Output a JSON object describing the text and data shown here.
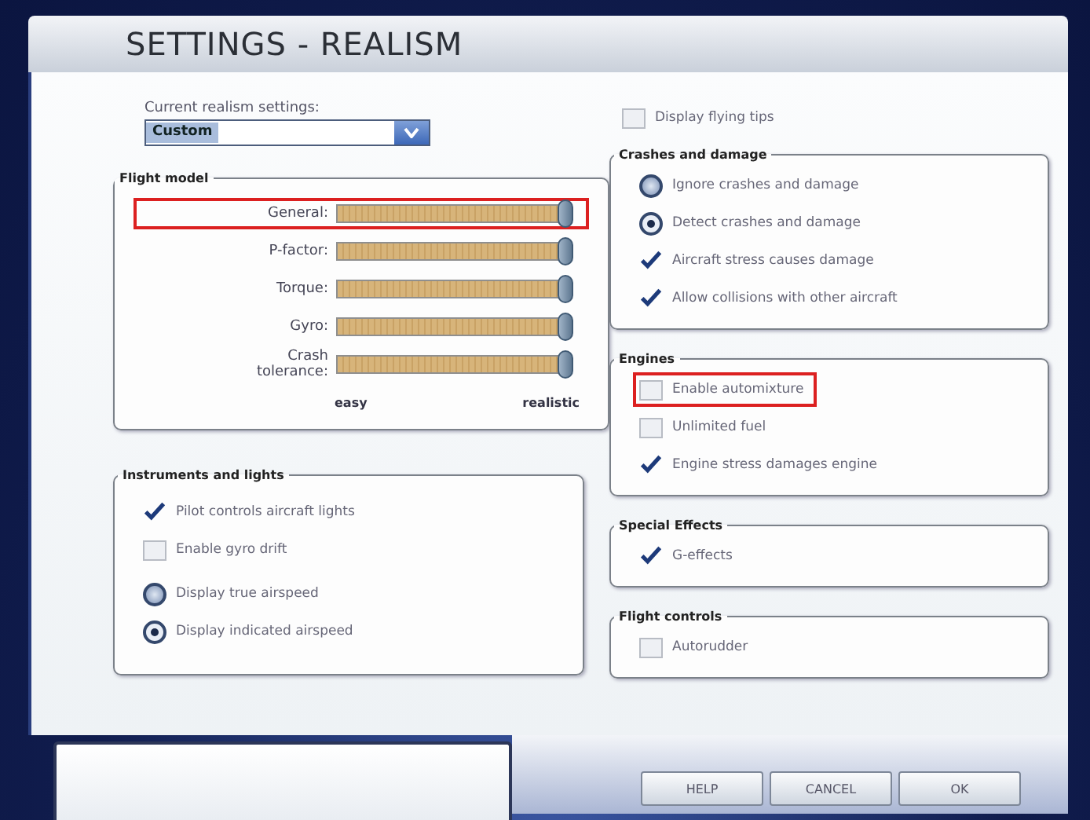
{
  "window": {
    "title": "SETTINGS - REALISM"
  },
  "realism": {
    "label": "Current realism settings:",
    "value": "Custom"
  },
  "flight_model": {
    "title": "Flight model",
    "sliders": [
      {
        "label": "General:",
        "level": 1,
        "highlighted": true
      },
      {
        "label": "P-factor:",
        "level": 1,
        "highlighted": false
      },
      {
        "label": "Torque:",
        "level": 1,
        "highlighted": false
      },
      {
        "label": "Gyro:",
        "level": 1,
        "highlighted": false
      },
      {
        "label": "Crash tolerance:",
        "level": 1,
        "highlighted": false
      }
    ],
    "scale": [
      "easy",
      "realistic"
    ]
  },
  "left_groups": [
    {
      "title": "Instruments and lights",
      "items": [
        {
          "kind": "checkbox",
          "label": "Pilot controls aircraft lights",
          "checked": true,
          "highlighted": false
        },
        {
          "kind": "checkbox",
          "label": "Enable gyro drift",
          "checked": false,
          "highlighted": false
        },
        {
          "kind": "radio",
          "label": "Display true airspeed",
          "selected": false,
          "highlighted": false
        },
        {
          "kind": "radio",
          "label": "Display indicated airspeed",
          "selected": true,
          "highlighted": false
        }
      ]
    }
  ],
  "flying_tips": {
    "label": "Display flying tips",
    "checked": false
  },
  "right_groups": [
    {
      "title": "Crashes and damage",
      "items": [
        {
          "kind": "radio",
          "label": "Ignore crashes and damage",
          "selected": false,
          "highlighted": false
        },
        {
          "kind": "radio",
          "label": "Detect crashes and damage",
          "selected": true,
          "highlighted": false
        },
        {
          "kind": "checkbox",
          "label": "Aircraft stress causes damage",
          "checked": true,
          "highlighted": false
        },
        {
          "kind": "checkbox",
          "label": "Allow collisions with other aircraft",
          "checked": true,
          "highlighted": false
        }
      ]
    },
    {
      "title": "Engines",
      "items": [
        {
          "kind": "checkbox",
          "label": "Enable automixture",
          "checked": false,
          "highlighted": true
        },
        {
          "kind": "checkbox",
          "label": "Unlimited fuel",
          "checked": false,
          "highlighted": false
        },
        {
          "kind": "checkbox",
          "label": "Engine stress damages engine",
          "checked": true,
          "highlighted": false
        }
      ]
    },
    {
      "title": "Special Effects",
      "items": [
        {
          "kind": "checkbox",
          "label": "G-effects",
          "checked": true,
          "highlighted": false
        }
      ]
    },
    {
      "title": "Flight controls",
      "items": [
        {
          "kind": "checkbox",
          "label": "Autorudder",
          "checked": false,
          "highlighted": false
        }
      ]
    }
  ],
  "buttons": [
    "HELP",
    "CANCEL",
    "OK"
  ]
}
